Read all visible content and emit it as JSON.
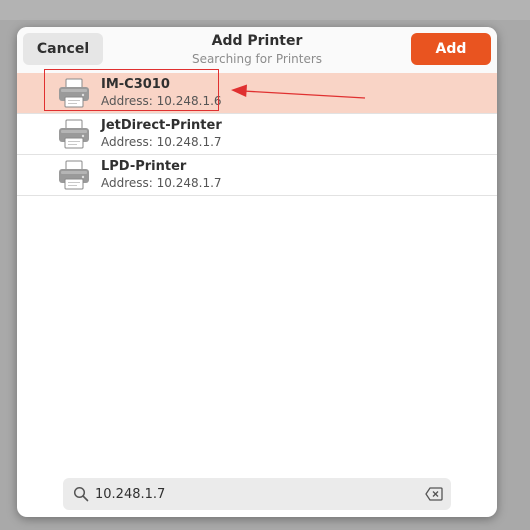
{
  "dialog": {
    "title": "Add Printer",
    "subtitle": "Searching for Printers",
    "cancel_label": "Cancel",
    "add_label": "Add",
    "accent_color": "#e95420",
    "selected_row_color": "#f9d4c6",
    "annotation_color": "#e03030"
  },
  "printers": [
    {
      "name": "IM-C3010",
      "address": "Address: 10.248.1.6",
      "icon": "printer-icon",
      "selected": true
    },
    {
      "name": "JetDirect-Printer",
      "address": "Address: 10.248.1.7",
      "icon": "printer-icon",
      "selected": false
    },
    {
      "name": "LPD-Printer",
      "address": "Address: 10.248.1.7",
      "icon": "printer-icon",
      "selected": false
    }
  ],
  "search": {
    "value": "10.248.1.7",
    "icon": "search-icon",
    "clear_icon": "backspace-clear-icon"
  }
}
